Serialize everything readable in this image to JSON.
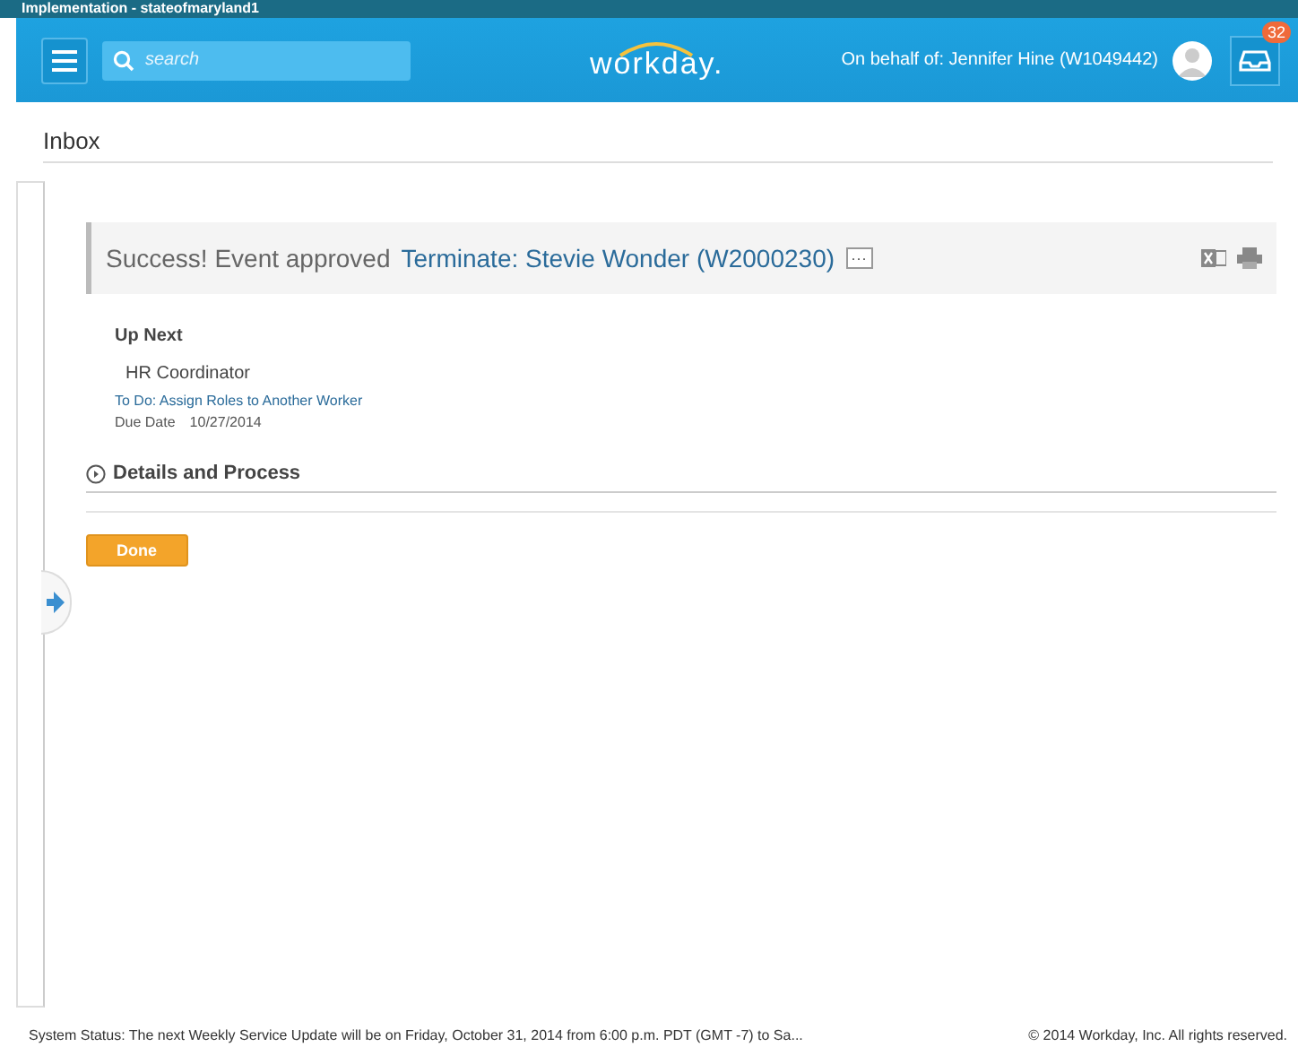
{
  "window": {
    "title": "Implementation - stateofmaryland1"
  },
  "header": {
    "search": {
      "placeholder": "search"
    },
    "logo": "workday.",
    "on_behalf": "On behalf of: Jennifer Hine (W1049442)",
    "inbox_badge": "32"
  },
  "page_title": "Inbox",
  "message": {
    "status": "Success! Event approved",
    "event_link": "Terminate: Stevie Wonder (W2000230)",
    "more": "···"
  },
  "up_next": {
    "heading": "Up Next",
    "role": "HR Coordinator",
    "todo_link": "To Do: Assign Roles to Another Worker",
    "due_label": "Due Date",
    "due_value": "10/27/2014"
  },
  "details": {
    "label": "Details and Process",
    "expanded": false
  },
  "done_button": "Done",
  "footer": {
    "status": "System Status: The next Weekly Service Update will be on Friday, October 31, 2014 from 6:00 p.m. PDT (GMT -7) to Sa...",
    "copyright": "© 2014 Workday, Inc. All rights reserved."
  }
}
